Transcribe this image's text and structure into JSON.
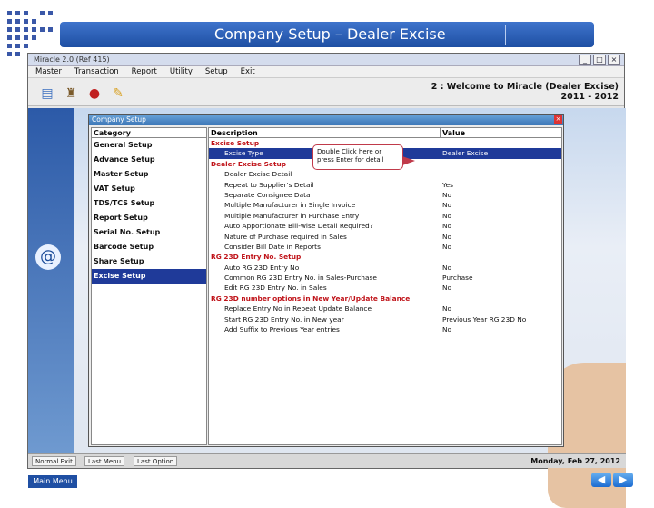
{
  "slide": {
    "title": "Company Setup – Dealer Excise"
  },
  "window": {
    "title": "Miracle 2.0 (Ref 415)"
  },
  "menu": [
    "Master",
    "Transaction",
    "Report",
    "Utility",
    "Setup",
    "Exit"
  ],
  "welcome": {
    "line1": "2 : Welcome to Miracle (Dealer Excise)",
    "line2": "2011 - 2012"
  },
  "dialog": {
    "title": "Company Setup",
    "category_header": "Category",
    "description_header": "Description",
    "value_header": "Value",
    "categories": [
      "General Setup",
      "Advance Setup",
      "Master Setup",
      "VAT Setup",
      "TDS/TCS Setup",
      "Report Setup",
      "Serial No. Setup",
      "Barcode Setup",
      "Share Setup",
      "Excise Setup"
    ],
    "rows": [
      {
        "desc": "Excise Setup",
        "value": ""
      },
      {
        "desc": "Excise Type",
        "value": "Dealer Excise"
      },
      {
        "desc": "Dealer Excise Setup",
        "value": ""
      },
      {
        "desc": "Dealer Excise Detail",
        "value": ""
      },
      {
        "desc": "Repeat to Supplier's Detail",
        "value": "Yes"
      },
      {
        "desc": "Separate Consignee Data",
        "value": "No"
      },
      {
        "desc": "Multiple Manufacturer in Single Invoice",
        "value": "No"
      },
      {
        "desc": "Multiple Manufacturer in Purchase Entry",
        "value": "No"
      },
      {
        "desc": "Auto Apportionate Bill-wise Detail Required?",
        "value": "No"
      },
      {
        "desc": "Nature of Purchase required in Sales",
        "value": "No"
      },
      {
        "desc": "Consider Bill Date in Reports",
        "value": "No"
      },
      {
        "desc": "RG 23D Entry No. Setup",
        "value": ""
      },
      {
        "desc": "Auto RG 23D Entry No",
        "value": "No"
      },
      {
        "desc": "Common RG 23D Entry No. in Sales-Purchase",
        "value": "Purchase"
      },
      {
        "desc": "Edit RG 23D Entry No. in Sales",
        "value": "No"
      },
      {
        "desc": "RG 23D number options in New Year/Update Balance",
        "value": ""
      },
      {
        "desc": "Replace Entry No in Repeat Update Balance",
        "value": "No"
      },
      {
        "desc": "Start RG 23D Entry No. in New year",
        "value": "Previous Year RG 23D No"
      },
      {
        "desc": "Add Suffix to Previous Year entries",
        "value": "No"
      }
    ],
    "tooltip": "Double Click here or press Enter for detail"
  },
  "statusbar": {
    "buttons": [
      "Normal Exit",
      "Last Menu",
      "Last Option"
    ],
    "date": "Monday, Feb 27, 2012"
  },
  "footer": {
    "main_menu": "Main Menu",
    "prev": "◀",
    "next": "▶"
  }
}
